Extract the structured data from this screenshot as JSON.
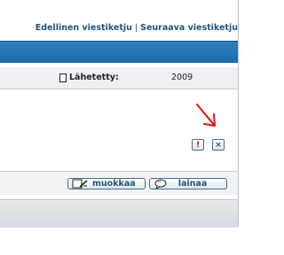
{
  "nav": {
    "prev_thread": "Edellinen viestiketju",
    "separator": "|",
    "next_thread": "Seuraava viestiketju"
  },
  "post": {
    "posted_label": "Lähetetty:",
    "posted_value": "2009"
  },
  "actions": {
    "report_icon_text": "!",
    "delete_icon_text": "×",
    "edit_label": "muokkaa",
    "quote_label": "lainaa"
  },
  "colors": {
    "header_blue": "#1a6aa8",
    "link_blue": "#22557a",
    "annotation_red": "#e01010"
  },
  "icons": [
    "document-icon",
    "report-icon",
    "delete-icon",
    "edit-icon",
    "quote-icon",
    "red-arrow-annotation"
  ]
}
